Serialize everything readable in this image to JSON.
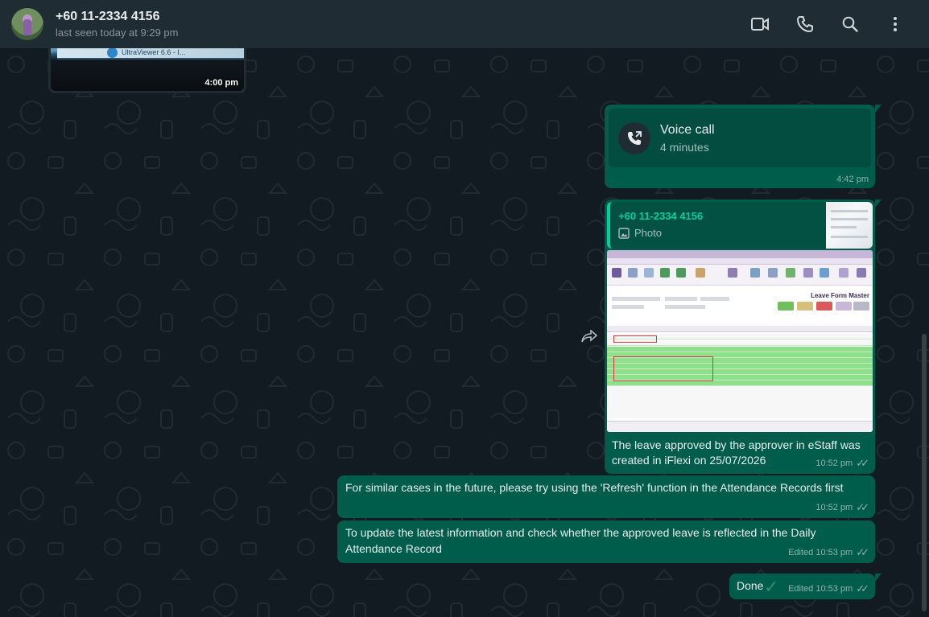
{
  "header": {
    "contact_name": "+60 11-2334 4156",
    "status": "last seen today at 9:29 pm",
    "actions": [
      "video-call-icon",
      "voice-call-icon",
      "search-icon",
      "menu-icon"
    ]
  },
  "messages": {
    "incoming_image": {
      "time": "4:00 pm",
      "window_text": "UltraViewer 6.6 - I..."
    },
    "voice_call": {
      "title": "Voice call",
      "duration": "4 minutes",
      "time": "4:42 pm"
    },
    "photo_reply": {
      "quoted_name": "+60 11-2334 4156",
      "quoted_type": "Photo",
      "screenshot_title": "Leave Form Master",
      "caption": "The leave approved by the approver in eStaff was created in iFlexi on 25/07/2026",
      "time": "10:52 pm"
    },
    "text_1": {
      "text": "For similar cases in the future, please try using the 'Refresh' function in the Attendance Records first",
      "time": "10:52 pm"
    },
    "text_2": {
      "text": "To update the latest information and check whether the approved leave is reflected in the Daily Attendance Record",
      "time": "Edited 10:53 pm"
    },
    "text_3": {
      "text": "Done",
      "time": "Edited 10:53 pm"
    }
  },
  "colors": {
    "header_bg": "#202c33",
    "chat_bg": "#111b21",
    "outgoing_bubble": "#005c4b",
    "accent": "#06cf9c"
  }
}
